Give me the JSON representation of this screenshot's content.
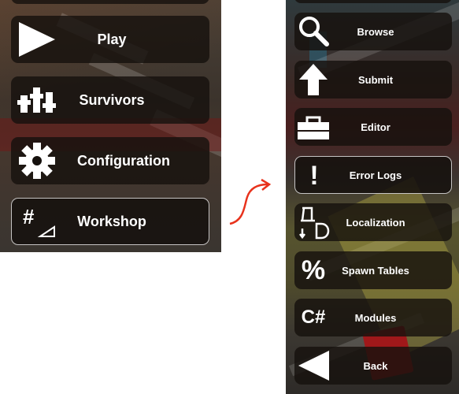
{
  "left_menu": {
    "items": [
      {
        "label": "Play",
        "icon": "play-icon"
      },
      {
        "label": "Survivors",
        "icon": "survivors-icon"
      },
      {
        "label": "Configuration",
        "icon": "gear-icon"
      },
      {
        "label": "Workshop",
        "icon": "workshop-icon",
        "selected": true
      }
    ]
  },
  "workshop_menu": {
    "items": [
      {
        "label": "Browse",
        "icon": "search-icon"
      },
      {
        "label": "Submit",
        "icon": "upload-arrow-icon"
      },
      {
        "label": "Editor",
        "icon": "toolbox-icon"
      },
      {
        "label": "Error Logs",
        "icon": "exclamation-icon",
        "selected": true
      },
      {
        "label": "Localization",
        "icon": "localization-icon"
      },
      {
        "label": "Spawn Tables",
        "icon": "percent-icon"
      },
      {
        "label": "Modules",
        "icon": "csharp-icon"
      },
      {
        "label": "Back",
        "icon": "back-arrow-icon"
      }
    ]
  },
  "icon_glyphs": {
    "workshop": "#",
    "error_logs": "!",
    "spawn_tables": "%",
    "modules": "C#"
  },
  "colors": {
    "button_bg": "#16110e",
    "text": "#ffffff",
    "transition_arrow": "#e8321c"
  }
}
